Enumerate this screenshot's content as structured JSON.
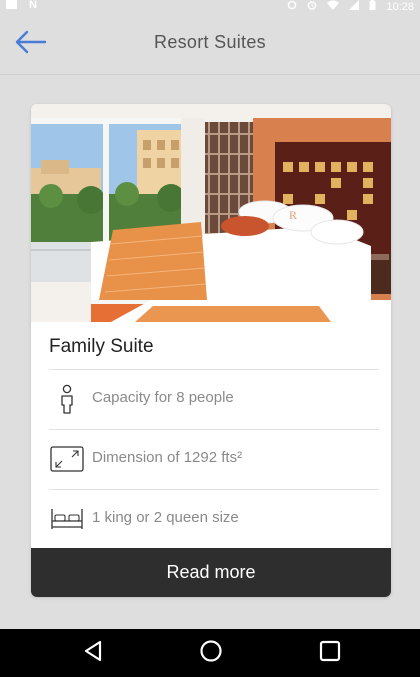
{
  "status_bar": {
    "time": "10:28",
    "left_icons": [
      "image-icon",
      "n-icon"
    ],
    "right_icons": [
      "sync-icon",
      "alarm-icon",
      "wifi-icon",
      "signal-icon",
      "battery-icon"
    ]
  },
  "app_bar": {
    "title": "Resort Suites",
    "back_icon": "arrow-left-icon",
    "accent_color": "#4a7bd9"
  },
  "card": {
    "image_icon": "hotel-room-photo",
    "name": "Family Suite",
    "features": [
      {
        "icon": "person-icon",
        "text": "Capacity for 8 people"
      },
      {
        "icon": "dimension-icon",
        "text": "Dimension of 1292 fts²"
      },
      {
        "icon": "bed-icon",
        "text": "1 king or 2 queen size"
      }
    ],
    "button_label": "Read more",
    "button_color": "#2e2e2e"
  },
  "nav_bar": {
    "buttons": [
      "back-triangle-icon",
      "home-circle-icon",
      "recents-square-icon"
    ]
  }
}
